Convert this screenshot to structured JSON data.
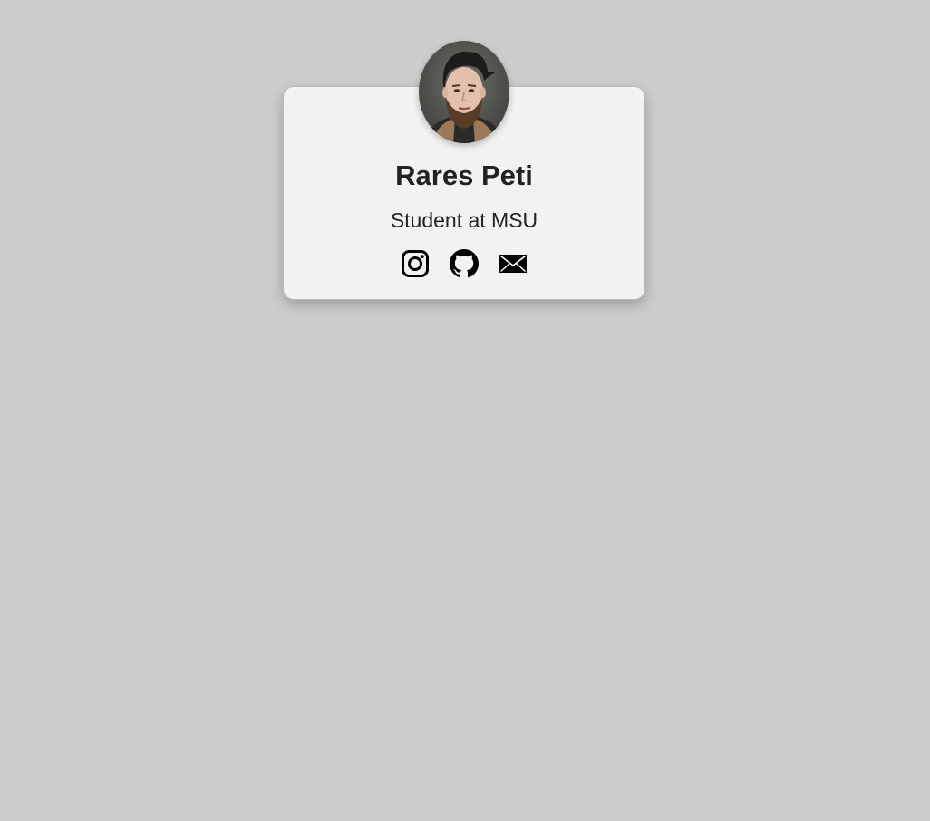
{
  "profile": {
    "name": "Rares Peti",
    "subtitle": "Student at MSU"
  },
  "socials": [
    {
      "icon": "instagram-icon"
    },
    {
      "icon": "github-icon"
    },
    {
      "icon": "mail-icon"
    }
  ],
  "colors": {
    "background": "#cccccc",
    "card": "#f2f2f2",
    "text": "#222222"
  }
}
